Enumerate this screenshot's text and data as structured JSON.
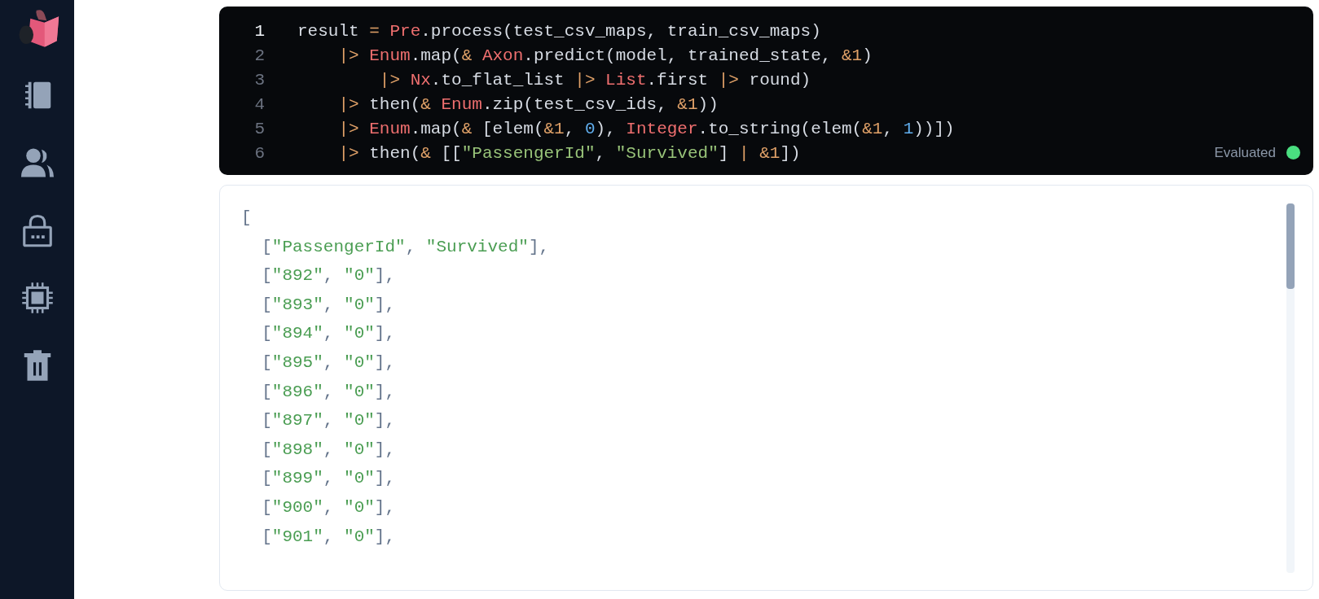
{
  "sidebar": {
    "items": [
      {
        "kind": "logo"
      },
      {
        "kind": "notebook"
      },
      {
        "kind": "users"
      },
      {
        "kind": "lock"
      },
      {
        "kind": "chip"
      },
      {
        "kind": "trash"
      }
    ]
  },
  "code_cell": {
    "lines": [
      {
        "number": "1",
        "active": true,
        "tokens": [
          {
            "kind": "plain",
            "text": "result "
          },
          {
            "kind": "op",
            "text": "= "
          },
          {
            "kind": "module",
            "text": "Pre"
          },
          {
            "kind": "plain",
            "text": ".process(test_csv_maps, train_csv_maps)"
          }
        ]
      },
      {
        "number": "2",
        "active": false,
        "tokens": [
          {
            "kind": "op",
            "text": "    |> "
          },
          {
            "kind": "module",
            "text": "Enum"
          },
          {
            "kind": "plain",
            "text": ".map("
          },
          {
            "kind": "op",
            "text": "& "
          },
          {
            "kind": "module",
            "text": "Axon"
          },
          {
            "kind": "plain",
            "text": ".predict(model, trained_state, "
          },
          {
            "kind": "op",
            "text": "&1"
          },
          {
            "kind": "plain",
            "text": ")"
          }
        ]
      },
      {
        "number": "3",
        "active": false,
        "tokens": [
          {
            "kind": "op",
            "text": "        |> "
          },
          {
            "kind": "module",
            "text": "Nx"
          },
          {
            "kind": "plain",
            "text": ".to_flat_list "
          },
          {
            "kind": "op",
            "text": "|> "
          },
          {
            "kind": "module",
            "text": "List"
          },
          {
            "kind": "plain",
            "text": ".first "
          },
          {
            "kind": "op",
            "text": "|>"
          },
          {
            "kind": "plain",
            "text": " round)"
          }
        ]
      },
      {
        "number": "4",
        "active": false,
        "tokens": [
          {
            "kind": "op",
            "text": "    |>"
          },
          {
            "kind": "plain",
            "text": " then("
          },
          {
            "kind": "op",
            "text": "& "
          },
          {
            "kind": "module",
            "text": "Enum"
          },
          {
            "kind": "plain",
            "text": ".zip(test_csv_ids, "
          },
          {
            "kind": "op",
            "text": "&1"
          },
          {
            "kind": "plain",
            "text": "))"
          }
        ]
      },
      {
        "number": "5",
        "active": false,
        "tokens": [
          {
            "kind": "op",
            "text": "    |> "
          },
          {
            "kind": "module",
            "text": "Enum"
          },
          {
            "kind": "plain",
            "text": ".map("
          },
          {
            "kind": "op",
            "text": "&"
          },
          {
            "kind": "plain",
            "text": " [elem("
          },
          {
            "kind": "op",
            "text": "&1"
          },
          {
            "kind": "plain",
            "text": ", "
          },
          {
            "kind": "number",
            "text": "0"
          },
          {
            "kind": "plain",
            "text": "), "
          },
          {
            "kind": "module",
            "text": "Integer"
          },
          {
            "kind": "plain",
            "text": ".to_string(elem("
          },
          {
            "kind": "op",
            "text": "&1"
          },
          {
            "kind": "plain",
            "text": ", "
          },
          {
            "kind": "number",
            "text": "1"
          },
          {
            "kind": "plain",
            "text": "))])"
          }
        ]
      },
      {
        "number": "6",
        "active": false,
        "tokens": [
          {
            "kind": "op",
            "text": "    |>"
          },
          {
            "kind": "plain",
            "text": " then("
          },
          {
            "kind": "op",
            "text": "&"
          },
          {
            "kind": "plain",
            "text": " [["
          },
          {
            "kind": "string",
            "text": "\"PassengerId\""
          },
          {
            "kind": "plain",
            "text": ", "
          },
          {
            "kind": "string",
            "text": "\"Survived\""
          },
          {
            "kind": "plain",
            "text": "] "
          },
          {
            "kind": "op",
            "text": "| &1"
          },
          {
            "kind": "plain",
            "text": "])"
          }
        ]
      }
    ],
    "status": {
      "label": "Evaluated",
      "color": "#4ade80"
    }
  },
  "output": {
    "lines": [
      [
        {
          "kind": "punct",
          "text": "["
        }
      ],
      [
        {
          "kind": "punct",
          "text": "  ["
        },
        {
          "kind": "string",
          "text": "\"PassengerId\""
        },
        {
          "kind": "punct",
          "text": ", "
        },
        {
          "kind": "string",
          "text": "\"Survived\""
        },
        {
          "kind": "punct",
          "text": "],"
        }
      ],
      [
        {
          "kind": "punct",
          "text": "  ["
        },
        {
          "kind": "string",
          "text": "\"892\""
        },
        {
          "kind": "punct",
          "text": ", "
        },
        {
          "kind": "string",
          "text": "\"0\""
        },
        {
          "kind": "punct",
          "text": "],"
        }
      ],
      [
        {
          "kind": "punct",
          "text": "  ["
        },
        {
          "kind": "string",
          "text": "\"893\""
        },
        {
          "kind": "punct",
          "text": ", "
        },
        {
          "kind": "string",
          "text": "\"0\""
        },
        {
          "kind": "punct",
          "text": "],"
        }
      ],
      [
        {
          "kind": "punct",
          "text": "  ["
        },
        {
          "kind": "string",
          "text": "\"894\""
        },
        {
          "kind": "punct",
          "text": ", "
        },
        {
          "kind": "string",
          "text": "\"0\""
        },
        {
          "kind": "punct",
          "text": "],"
        }
      ],
      [
        {
          "kind": "punct",
          "text": "  ["
        },
        {
          "kind": "string",
          "text": "\"895\""
        },
        {
          "kind": "punct",
          "text": ", "
        },
        {
          "kind": "string",
          "text": "\"0\""
        },
        {
          "kind": "punct",
          "text": "],"
        }
      ],
      [
        {
          "kind": "punct",
          "text": "  ["
        },
        {
          "kind": "string",
          "text": "\"896\""
        },
        {
          "kind": "punct",
          "text": ", "
        },
        {
          "kind": "string",
          "text": "\"0\""
        },
        {
          "kind": "punct",
          "text": "],"
        }
      ],
      [
        {
          "kind": "punct",
          "text": "  ["
        },
        {
          "kind": "string",
          "text": "\"897\""
        },
        {
          "kind": "punct",
          "text": ", "
        },
        {
          "kind": "string",
          "text": "\"0\""
        },
        {
          "kind": "punct",
          "text": "],"
        }
      ],
      [
        {
          "kind": "punct",
          "text": "  ["
        },
        {
          "kind": "string",
          "text": "\"898\""
        },
        {
          "kind": "punct",
          "text": ", "
        },
        {
          "kind": "string",
          "text": "\"0\""
        },
        {
          "kind": "punct",
          "text": "],"
        }
      ],
      [
        {
          "kind": "punct",
          "text": "  ["
        },
        {
          "kind": "string",
          "text": "\"899\""
        },
        {
          "kind": "punct",
          "text": ", "
        },
        {
          "kind": "string",
          "text": "\"0\""
        },
        {
          "kind": "punct",
          "text": "],"
        }
      ],
      [
        {
          "kind": "punct",
          "text": "  ["
        },
        {
          "kind": "string",
          "text": "\"900\""
        },
        {
          "kind": "punct",
          "text": ", "
        },
        {
          "kind": "string",
          "text": "\"0\""
        },
        {
          "kind": "punct",
          "text": "],"
        }
      ],
      [
        {
          "kind": "punct",
          "text": "  ["
        },
        {
          "kind": "string",
          "text": "\"901\""
        },
        {
          "kind": "punct",
          "text": ", "
        },
        {
          "kind": "string",
          "text": "\"0\""
        },
        {
          "kind": "punct",
          "text": "],"
        }
      ]
    ]
  }
}
